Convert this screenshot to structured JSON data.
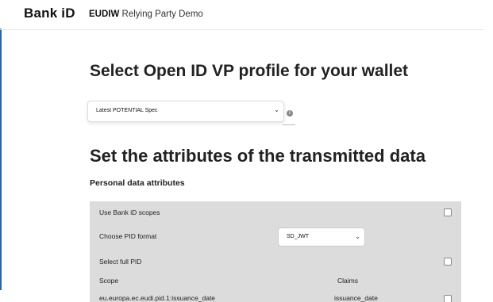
{
  "header": {
    "brand": "Bank iD",
    "app_strong": "EUDIW",
    "app_rest": " Relying Party Demo"
  },
  "profile": {
    "heading": "Select Open ID VP profile for your wallet",
    "selected": "Latest POTENTIAL Spec",
    "info_icon": "info-icon"
  },
  "attributes": {
    "heading": "Set the attributes of the transmitted data",
    "subheading": "Personal data attributes",
    "rows": {
      "use_scopes": "Use Bank iD scopes",
      "choose_format": "Choose PID format",
      "pid_format_value": "SD_JWT",
      "select_full": "Select full PID"
    },
    "table": {
      "col_scope": "Scope",
      "col_claims": "Claims",
      "first_scope": "eu.europa.ec.eudi.pid.1:issuance_date",
      "first_claim": "issuance_date"
    }
  },
  "colors": {
    "panel": "#dcdcdc",
    "sidebar_edge": "#2f63a8"
  }
}
